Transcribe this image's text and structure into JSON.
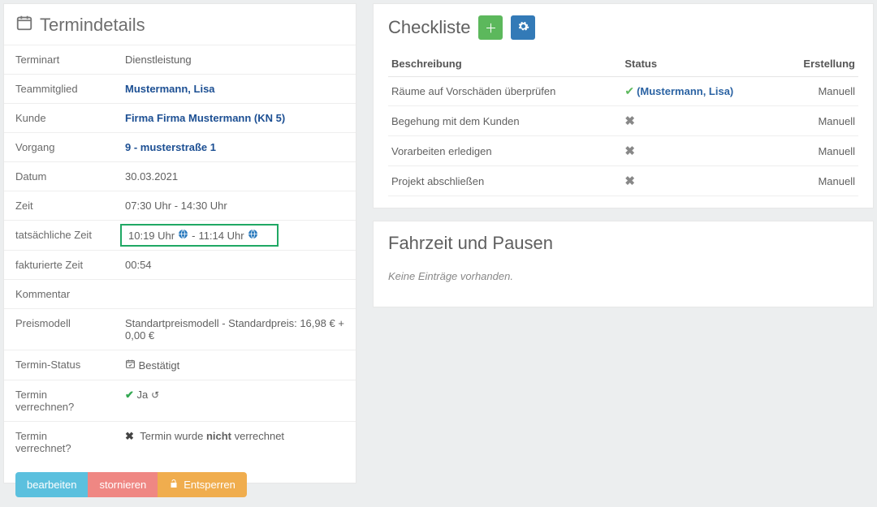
{
  "details_panel": {
    "title": "Termindetails",
    "rows": {
      "terminart_label": "Terminart",
      "terminart_value": "Dienstleistung",
      "team_label": "Teammitglied",
      "team_value": "Mustermann, Lisa",
      "kunde_label": "Kunde",
      "kunde_value": "Firma Firma Mustermann (KN 5)",
      "vorgang_label": "Vorgang",
      "vorgang_value": "9 - musterstraße 1",
      "datum_label": "Datum",
      "datum_value": "30.03.2021",
      "zeit_label": "Zeit",
      "zeit_value": "07:30 Uhr - 14:30 Uhr",
      "tzeit_label": "tatsächliche Zeit",
      "tzeit_start": "10:19 Uhr",
      "tzeit_sep": " - ",
      "tzeit_end": "11:14 Uhr",
      "fzeit_label": "fakturierte Zeit",
      "fzeit_value": "00:54",
      "kommentar_label": "Kommentar",
      "preis_label": "Preismodell",
      "preis_value": "Standartpreismodell - Standardpreis: 16,98 € + 0,00 €",
      "status_label": "Termin-Status",
      "status_value": "Bestätigt",
      "verrechnen_label": "Termin verrechnen?",
      "verrechnen_value": "Ja",
      "verrechnet_label": "Termin verrechnet?",
      "verrechnet_prefix": "Termin wurde ",
      "verrechnet_bold": "nicht",
      "verrechnet_suffix": " verrechnet"
    },
    "buttons": {
      "edit": "bearbeiten",
      "cancel": "stornieren",
      "unlock": "Entsperren"
    }
  },
  "checklist": {
    "title": "Checkliste",
    "columns": {
      "desc": "Beschreibung",
      "status": "Status",
      "creation": "Erstellung"
    },
    "items": [
      {
        "desc": "Räume auf Vorschäden überprüfen",
        "done": true,
        "by": "(Mustermann, Lisa)",
        "creation": "Manuell"
      },
      {
        "desc": "Begehung mit dem Kunden",
        "done": false,
        "creation": "Manuell"
      },
      {
        "desc": "Vorarbeiten erledigen",
        "done": false,
        "creation": "Manuell"
      },
      {
        "desc": "Projekt abschließen",
        "done": false,
        "creation": "Manuell"
      }
    ]
  },
  "travel": {
    "title": "Fahrzeit und Pausen",
    "empty": "Keine Einträge vorhanden."
  }
}
